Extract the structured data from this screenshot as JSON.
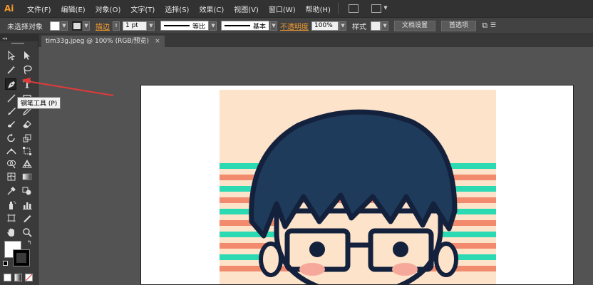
{
  "app": {
    "logo": "Ai"
  },
  "menu": [
    "文件(F)",
    "编辑(E)",
    "对象(O)",
    "文字(T)",
    "选择(S)",
    "效果(C)",
    "视图(V)",
    "窗口(W)",
    "帮助(H)"
  ],
  "control_bar": {
    "no_selection": "未选择对象",
    "stroke_label": "描边",
    "stroke_weight": "1 pt",
    "profile_label": "等比",
    "brush_label": "基本",
    "opacity_label": "不透明度",
    "opacity_value": "100%",
    "style_label": "样式",
    "doc_setup_button": "文档设置",
    "preferences_button": "首选项"
  },
  "document": {
    "tab_title": "tim33g.jpeg @ 100% (RGB/预览)",
    "tab_close": "×"
  },
  "toolbox": {
    "tooltip": "钢笔工具 (P)"
  },
  "colors": {
    "accent": "#f29a2e",
    "arrow": "#e23a3a",
    "hair": "#1f3b5c",
    "outline": "#14213d",
    "background": "#fde3c9",
    "stripe_teal": "#2bd9b3",
    "stripe_salmon": "#f28b6e",
    "skin": "#fde3c9",
    "blush": "#f6a99b"
  }
}
